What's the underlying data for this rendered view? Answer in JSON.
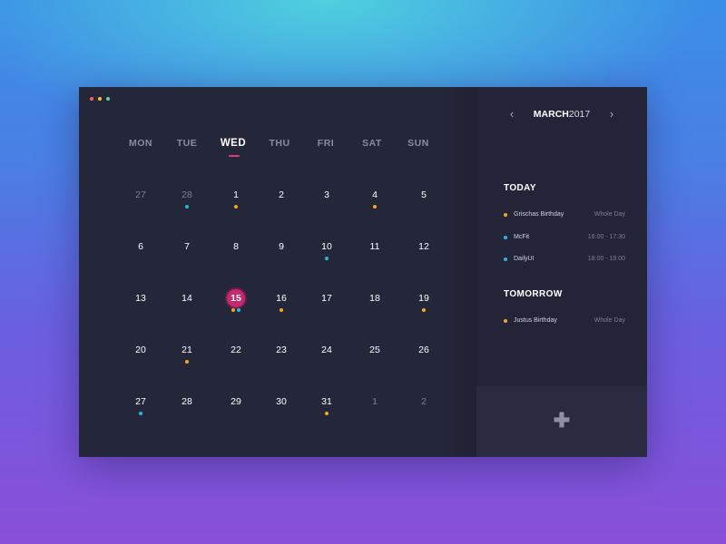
{
  "colors": {
    "window_bg": "#242639",
    "sidebar_bg": "#232437",
    "accent_pink": "#e0397f",
    "today_circle": "#c22a6f",
    "orange": "#f5a623",
    "cyan": "#25b8d9",
    "traffic_red": "#ff5f57",
    "traffic_yellow": "#febc2e",
    "traffic_green": "#59d7a0"
  },
  "calendar": {
    "weekdays": [
      "MON",
      "TUE",
      "WED",
      "THU",
      "FRI",
      "SAT",
      "SUN"
    ],
    "active_weekday": "WED",
    "weeks": [
      [
        {
          "d": "27",
          "muted": true,
          "dots": []
        },
        {
          "d": "28",
          "muted": true,
          "dots": [
            "cyan"
          ]
        },
        {
          "d": "1",
          "dots": [
            "orange"
          ]
        },
        {
          "d": "2",
          "dots": []
        },
        {
          "d": "3",
          "dots": []
        },
        {
          "d": "4",
          "dots": [
            "orange"
          ]
        },
        {
          "d": "5",
          "dots": []
        }
      ],
      [
        {
          "d": "6",
          "dots": []
        },
        {
          "d": "7",
          "dots": []
        },
        {
          "d": "8",
          "dots": []
        },
        {
          "d": "9",
          "dots": []
        },
        {
          "d": "10",
          "dots": [
            "cyan"
          ]
        },
        {
          "d": "11",
          "dots": []
        },
        {
          "d": "12",
          "dots": []
        }
      ],
      [
        {
          "d": "13",
          "dots": []
        },
        {
          "d": "14",
          "dots": []
        },
        {
          "d": "15",
          "today": true,
          "dots": [
            "orange",
            "cyan"
          ]
        },
        {
          "d": "16",
          "dots": [
            "orange"
          ]
        },
        {
          "d": "17",
          "dots": []
        },
        {
          "d": "18",
          "dots": []
        },
        {
          "d": "19",
          "dots": [
            "orange"
          ]
        }
      ],
      [
        {
          "d": "20",
          "dots": []
        },
        {
          "d": "21",
          "dots": [
            "orange"
          ]
        },
        {
          "d": "22",
          "dots": []
        },
        {
          "d": "23",
          "dots": []
        },
        {
          "d": "24",
          "dots": []
        },
        {
          "d": "25",
          "dots": []
        },
        {
          "d": "26",
          "dots": []
        }
      ],
      [
        {
          "d": "27",
          "dots": [
            "cyan"
          ]
        },
        {
          "d": "28",
          "dots": []
        },
        {
          "d": "29",
          "dots": []
        },
        {
          "d": "30",
          "dots": []
        },
        {
          "d": "31",
          "dots": [
            "orange"
          ]
        },
        {
          "d": "1",
          "muted": true,
          "dots": []
        },
        {
          "d": "2",
          "muted": true,
          "dots": []
        }
      ]
    ]
  },
  "sidebar": {
    "prev_icon": "chevron-left-icon",
    "next_icon": "chevron-right-icon",
    "prev_glyph": "‹",
    "next_glyph": "›",
    "month": "MARCH",
    "year": "2017",
    "today_title": "TODAY",
    "today_events": [
      {
        "name": "Grischas Birthday",
        "time": "Whole Day",
        "color": "orange"
      },
      {
        "name": "McFit",
        "time": "16:00 - 17:30",
        "color": "cyan"
      },
      {
        "name": "DailyUI",
        "time": "18:00 - 19:00",
        "color": "cyan"
      }
    ],
    "tomorrow_title": "TOMORROW",
    "tomorrow_events": [
      {
        "name": "Justus Birthday",
        "time": "Whole Day",
        "color": "orange"
      }
    ],
    "add_icon": "plus-icon",
    "add_glyph": "✚"
  }
}
